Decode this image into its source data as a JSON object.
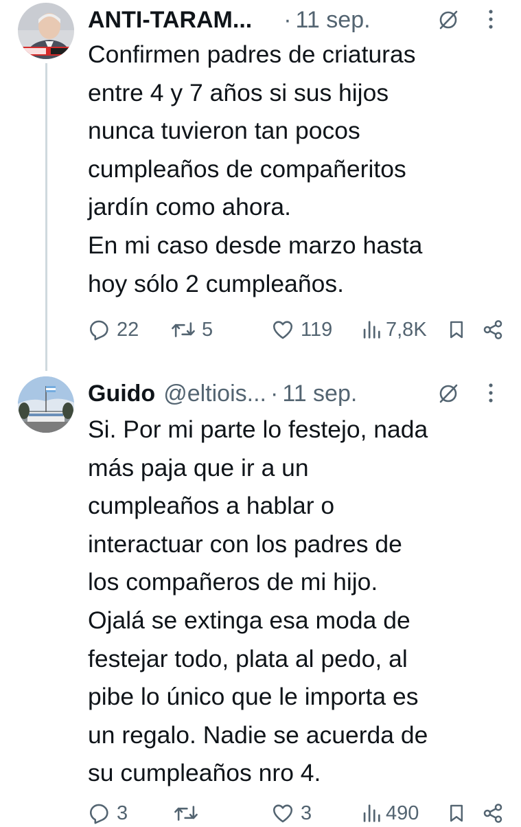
{
  "tweets": [
    {
      "author_name": "ANTI-TARAM...",
      "handle": "",
      "separator": "·",
      "time": "11 sep.",
      "text": "Confirmen padres de criaturas\nentre 4 y 7 años si sus hijos\nnunca tuvieron tan pocos\ncumpleaños de compañeritos\njardín como ahora.\nEn mi caso desde marzo hasta\nhoy sólo 2 cumpleaños.",
      "replies": "22",
      "retweets": "5",
      "likes": "119",
      "views": "7,8K"
    },
    {
      "author_name": "Guido",
      "handle": "@eltiois...",
      "separator": "·",
      "time": "11 sep.",
      "text": "Si. Por mi parte lo festejo, nada\nmás paja que ir a un\ncumpleaños a hablar o\ninteractuar con los padres de\nlos compañeros de mi hijo.\nOjalá se extinga esa moda de\nfestejar todo, plata al pedo, al\npibe lo único que le importa es\nun regalo. Nadie se acuerda de\nsu cumpleaños nro 4.",
      "replies": "3",
      "retweets": "",
      "likes": "3",
      "views": "490"
    }
  ],
  "colors": {
    "text": "#0f1419",
    "secondary": "#536471",
    "thread_line": "#cfd9de"
  },
  "icons": [
    "reply-icon",
    "retweet-icon",
    "like-icon",
    "views-icon",
    "bookmark-icon",
    "share-icon",
    "grok-icon",
    "more-icon"
  ]
}
